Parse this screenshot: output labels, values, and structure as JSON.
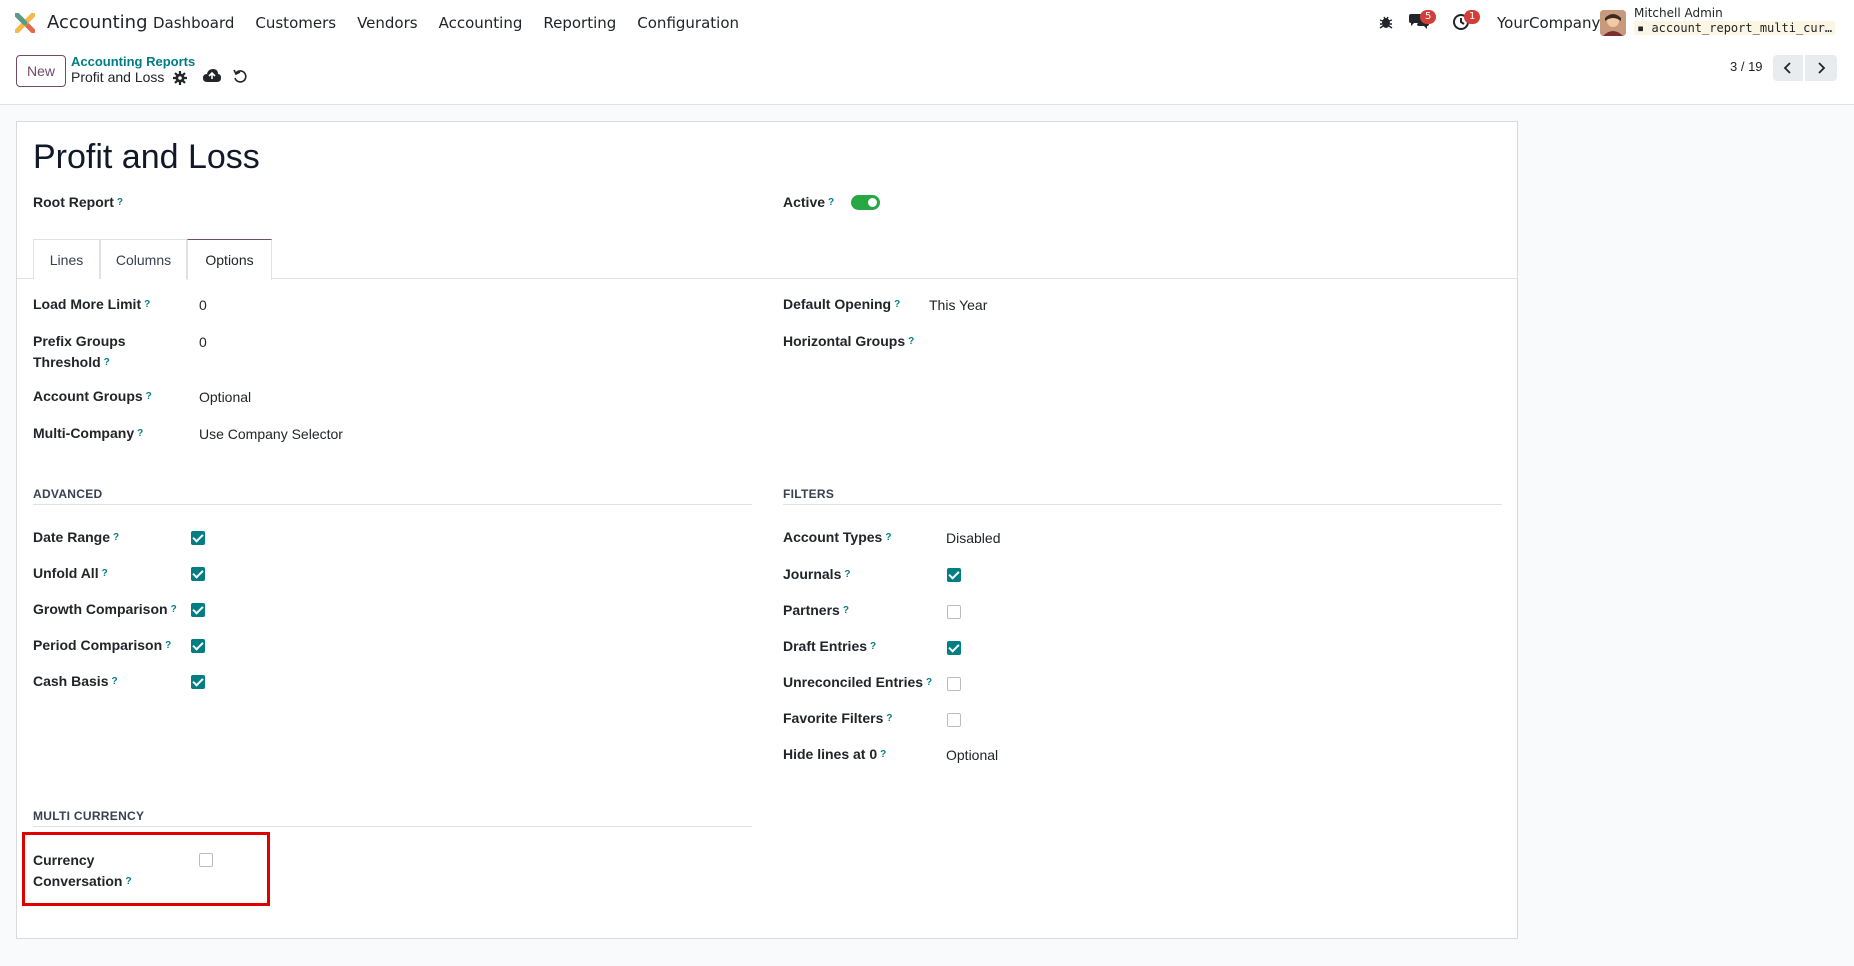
{
  "navbar": {
    "app_name": "Accounting",
    "menu": [
      "Dashboard",
      "Customers",
      "Vendors",
      "Accounting",
      "Reporting",
      "Configuration"
    ],
    "messages_count": "5",
    "activities_count": "1",
    "company": "YourCompany",
    "user_name": "Mitchell Admin",
    "database": "account_report_multi_cur…"
  },
  "control_panel": {
    "new_label": "New",
    "breadcrumb_parent": "Accounting Reports",
    "breadcrumb_current": "Profit and Loss",
    "pager": "3 / 19"
  },
  "form": {
    "title": "Profit and Loss",
    "root_report_label": "Root Report",
    "active_label": "Active",
    "active": true,
    "tabs": [
      "Lines",
      "Columns",
      "Options"
    ],
    "active_tab": "Options",
    "options_left": [
      {
        "label": "Load More Limit",
        "value": "0"
      },
      {
        "label": "Prefix Groups Threshold",
        "value": "0"
      },
      {
        "label": "Account Groups",
        "value": "Optional"
      },
      {
        "label": "Multi-Company",
        "value": "Use Company Selector"
      }
    ],
    "options_right": [
      {
        "label": "Default Opening",
        "value": "This Year"
      },
      {
        "label": "Horizontal Groups",
        "value": ""
      }
    ],
    "advanced": {
      "title": "ADVANCED",
      "items": [
        {
          "label": "Date Range",
          "checked": true
        },
        {
          "label": "Unfold All",
          "checked": true
        },
        {
          "label": "Growth Comparison",
          "checked": true
        },
        {
          "label": "Period Comparison",
          "checked": true
        },
        {
          "label": "Cash Basis",
          "checked": true
        }
      ]
    },
    "filters": {
      "title": "FILTERS",
      "account_types_label": "Account Types",
      "account_types_value": "Disabled",
      "items": [
        {
          "label": "Journals",
          "checked": true
        },
        {
          "label": "Partners",
          "checked": false
        },
        {
          "label": "Draft Entries",
          "checked": true
        },
        {
          "label": "Unreconciled Entries",
          "checked": false
        },
        {
          "label": "Favorite Filters",
          "checked": false
        }
      ],
      "hide_lines_label": "Hide lines at 0",
      "hide_lines_value": "Optional"
    },
    "multi_currency": {
      "title": "MULTI CURRENCY",
      "currency_label_line1": "Currency",
      "currency_label_line2": "Conversation",
      "checked": false
    }
  },
  "colors": {
    "brand": "#714b67",
    "accent": "#017e84",
    "toggle_on": "#28a745",
    "badge": "#d23f3a",
    "highlight": "#e00000"
  }
}
